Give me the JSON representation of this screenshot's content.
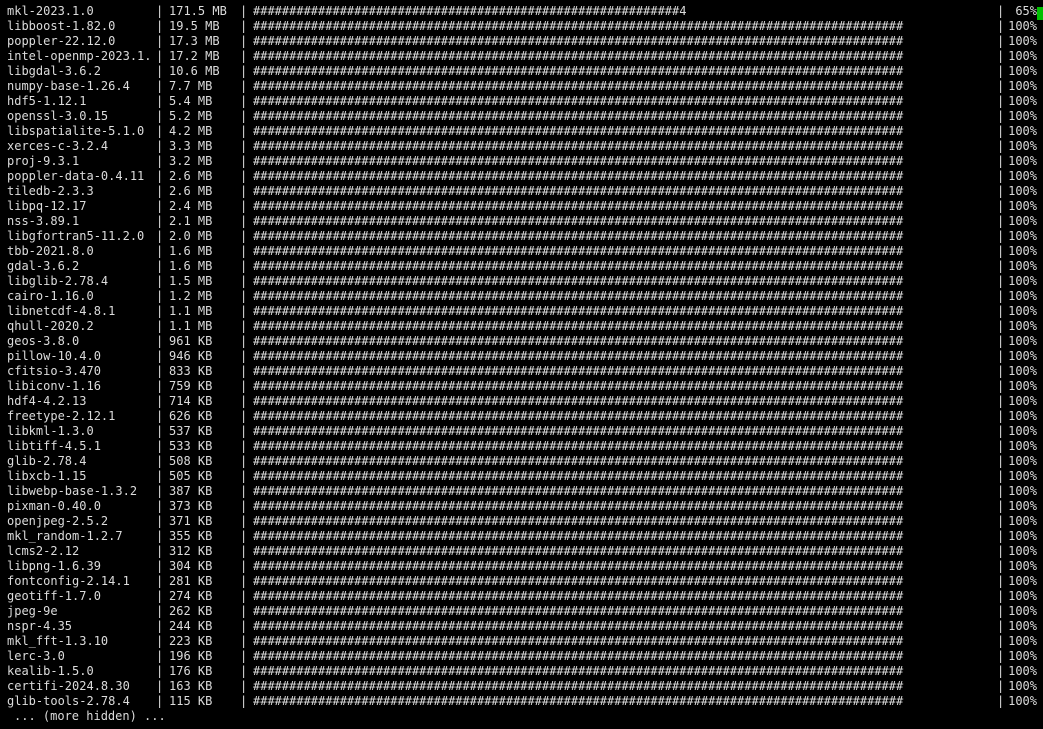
{
  "terminal": {
    "packages": [
      {
        "name": "mkl-2023.1.0",
        "size": "171.5 MB",
        "bar": "###########################################################4",
        "percent": "65%"
      },
      {
        "name": "libboost-1.82.0",
        "size": "19.5 MB",
        "bar": "##########################################################################################",
        "percent": "100%"
      },
      {
        "name": "poppler-22.12.0",
        "size": "17.3 MB",
        "bar": "##########################################################################################",
        "percent": "100%"
      },
      {
        "name": "intel-openmp-2023.1.",
        "size": "17.2 MB",
        "bar": "##########################################################################################",
        "percent": "100%"
      },
      {
        "name": "libgdal-3.6.2",
        "size": "10.6 MB",
        "bar": "##########################################################################################",
        "percent": "100%"
      },
      {
        "name": "numpy-base-1.26.4",
        "size": "7.7 MB",
        "bar": "##########################################################################################",
        "percent": "100%"
      },
      {
        "name": "hdf5-1.12.1",
        "size": "5.4 MB",
        "bar": "##########################################################################################",
        "percent": "100%"
      },
      {
        "name": "openssl-3.0.15",
        "size": "5.2 MB",
        "bar": "##########################################################################################",
        "percent": "100%"
      },
      {
        "name": "libspatialite-5.1.0",
        "size": "4.2 MB",
        "bar": "##########################################################################################",
        "percent": "100%"
      },
      {
        "name": "xerces-c-3.2.4",
        "size": "3.3 MB",
        "bar": "##########################################################################################",
        "percent": "100%"
      },
      {
        "name": "proj-9.3.1",
        "size": "3.2 MB",
        "bar": "##########################################################################################",
        "percent": "100%"
      },
      {
        "name": "poppler-data-0.4.11",
        "size": "2.6 MB",
        "bar": "##########################################################################################",
        "percent": "100%"
      },
      {
        "name": "tiledb-2.3.3",
        "size": "2.6 MB",
        "bar": "##########################################################################################",
        "percent": "100%"
      },
      {
        "name": "libpq-12.17",
        "size": "2.4 MB",
        "bar": "##########################################################################################",
        "percent": "100%"
      },
      {
        "name": "nss-3.89.1",
        "size": "2.1 MB",
        "bar": "##########################################################################################",
        "percent": "100%"
      },
      {
        "name": "libgfortran5-11.2.0",
        "size": "2.0 MB",
        "bar": "##########################################################################################",
        "percent": "100%"
      },
      {
        "name": "tbb-2021.8.0",
        "size": "1.6 MB",
        "bar": "##########################################################################################",
        "percent": "100%"
      },
      {
        "name": "gdal-3.6.2",
        "size": "1.6 MB",
        "bar": "##########################################################################################",
        "percent": "100%"
      },
      {
        "name": "libglib-2.78.4",
        "size": "1.5 MB",
        "bar": "##########################################################################################",
        "percent": "100%"
      },
      {
        "name": "cairo-1.16.0",
        "size": "1.2 MB",
        "bar": "##########################################################################################",
        "percent": "100%"
      },
      {
        "name": "libnetcdf-4.8.1",
        "size": "1.1 MB",
        "bar": "##########################################################################################",
        "percent": "100%"
      },
      {
        "name": "qhull-2020.2",
        "size": "1.1 MB",
        "bar": "##########################################################################################",
        "percent": "100%"
      },
      {
        "name": "geos-3.8.0",
        "size": "961 KB",
        "bar": "##########################################################################################",
        "percent": "100%"
      },
      {
        "name": "pillow-10.4.0",
        "size": "946 KB",
        "bar": "##########################################################################################",
        "percent": "100%"
      },
      {
        "name": "cfitsio-3.470",
        "size": "833 KB",
        "bar": "##########################################################################################",
        "percent": "100%"
      },
      {
        "name": "libiconv-1.16",
        "size": "759 KB",
        "bar": "##########################################################################################",
        "percent": "100%"
      },
      {
        "name": "hdf4-4.2.13",
        "size": "714 KB",
        "bar": "##########################################################################################",
        "percent": "100%"
      },
      {
        "name": "freetype-2.12.1",
        "size": "626 KB",
        "bar": "##########################################################################################",
        "percent": "100%"
      },
      {
        "name": "libkml-1.3.0",
        "size": "537 KB",
        "bar": "##########################################################################################",
        "percent": "100%"
      },
      {
        "name": "libtiff-4.5.1",
        "size": "533 KB",
        "bar": "##########################################################################################",
        "percent": "100%"
      },
      {
        "name": "glib-2.78.4",
        "size": "508 KB",
        "bar": "##########################################################################################",
        "percent": "100%"
      },
      {
        "name": "libxcb-1.15",
        "size": "505 KB",
        "bar": "##########################################################################################",
        "percent": "100%"
      },
      {
        "name": "libwebp-base-1.3.2",
        "size": "387 KB",
        "bar": "##########################################################################################",
        "percent": "100%"
      },
      {
        "name": "pixman-0.40.0",
        "size": "373 KB",
        "bar": "##########################################################################################",
        "percent": "100%"
      },
      {
        "name": "openjpeg-2.5.2",
        "size": "371 KB",
        "bar": "##########################################################################################",
        "percent": "100%"
      },
      {
        "name": "mkl_random-1.2.7",
        "size": "355 KB",
        "bar": "##########################################################################################",
        "percent": "100%"
      },
      {
        "name": "lcms2-2.12",
        "size": "312 KB",
        "bar": "##########################################################################################",
        "percent": "100%"
      },
      {
        "name": "libpng-1.6.39",
        "size": "304 KB",
        "bar": "##########################################################################################",
        "percent": "100%"
      },
      {
        "name": "fontconfig-2.14.1",
        "size": "281 KB",
        "bar": "##########################################################################################",
        "percent": "100%"
      },
      {
        "name": "geotiff-1.7.0",
        "size": "274 KB",
        "bar": "##########################################################################################",
        "percent": "100%"
      },
      {
        "name": "jpeg-9e",
        "size": "262 KB",
        "bar": "##########################################################################################",
        "percent": "100%"
      },
      {
        "name": "nspr-4.35",
        "size": "244 KB",
        "bar": "##########################################################################################",
        "percent": "100%"
      },
      {
        "name": "mkl_fft-1.3.10",
        "size": "223 KB",
        "bar": "##########################################################################################",
        "percent": "100%"
      },
      {
        "name": "lerc-3.0",
        "size": "196 KB",
        "bar": "##########################################################################################",
        "percent": "100%"
      },
      {
        "name": "kealib-1.5.0",
        "size": "176 KB",
        "bar": "##########################################################################################",
        "percent": "100%"
      },
      {
        "name": "certifi-2024.8.30",
        "size": "163 KB",
        "bar": "##########################################################################################",
        "percent": "100%"
      },
      {
        "name": "glib-tools-2.78.4",
        "size": "115 KB",
        "bar": "##########################################################################################",
        "percent": "100%"
      }
    ],
    "more_hidden": "... (more hidden) ...",
    "colors": {
      "background": "#000000",
      "text": "#dcdcdc",
      "cursor": "#00c000"
    }
  }
}
